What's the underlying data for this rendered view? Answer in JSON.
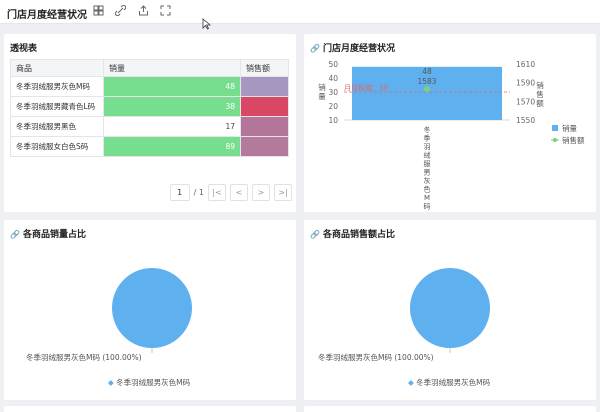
{
  "header": {
    "title": "门店月度经营状况"
  },
  "pivot": {
    "title": "透视表",
    "columns": [
      "商品",
      "销量",
      "销售额"
    ],
    "rows": [
      {
        "product": "冬季羽绒服男灰色M码",
        "qty": "48",
        "qty_frac": 1.0,
        "sales_color": "#a597bf"
      },
      {
        "product": "冬季羽绒服男藏青色L码",
        "qty": "38",
        "qty_frac": 1.0,
        "sales_color": "#d94865"
      },
      {
        "product": "冬季羽绒服男黑色",
        "qty": "17",
        "qty_frac": 0,
        "sales_color": "#b37598"
      },
      {
        "product": "冬季羽绒服女白色S码",
        "qty": "89",
        "qty_frac": 1.0,
        "sales_color": "#b37a9c"
      }
    ],
    "pager": {
      "current": "1",
      "total": "/ 1",
      "first": "|<",
      "prev": "<",
      "next": ">",
      "last": ">|"
    }
  },
  "combo": {
    "title": "门店月度经营状况",
    "left_axis_label": "销量",
    "right_axis_label": "销售额",
    "target_label": "月目标值：30",
    "legend": [
      "销量",
      "销售额"
    ],
    "colors": {
      "bar": "#5fb0ef",
      "line": "#7ed07e",
      "target": "#e06666"
    }
  },
  "pie1": {
    "title": "各商品销量占比",
    "label": "冬季羽绒服男灰色M码 (100.00%)",
    "legend": "冬季羽绒服男灰色M码"
  },
  "pie2": {
    "title": "各商品销售额占比",
    "label": "冬季羽绒服男灰色M码 (100.00%)",
    "legend": "冬季羽绒服男灰色M码"
  },
  "chart_data": [
    {
      "type": "bar",
      "categories": [
        "冬季羽绒服男灰色M码"
      ],
      "series": [
        {
          "name": "销量",
          "values": [
            48
          ]
        },
        {
          "name": "销售额",
          "values": [
            1583
          ]
        }
      ],
      "left_ylim": [
        10,
        50
      ],
      "left_ticks": [
        "10",
        "20",
        "30",
        "40",
        "50"
      ],
      "right_ylim": [
        1550,
        1610
      ],
      "right_ticks": [
        "1550",
        "1570",
        "1590",
        "1610"
      ],
      "target": 30,
      "bar_label": "48",
      "line_label": "1583"
    },
    {
      "type": "pie",
      "labels": [
        "冬季羽绒服男灰色M码"
      ],
      "values": [
        100
      ]
    },
    {
      "type": "pie",
      "labels": [
        "冬季羽绒服男灰色M码"
      ],
      "values": [
        100
      ]
    }
  ]
}
